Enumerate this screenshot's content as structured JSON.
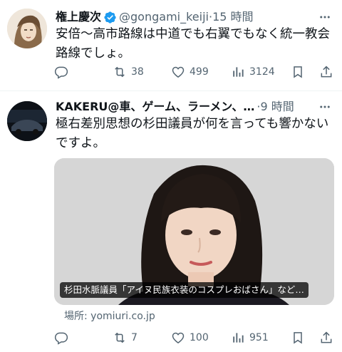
{
  "tweet1": {
    "name": "権上慶次",
    "handle": "@gongami_keiji",
    "separator": "·",
    "time": "15 時間",
    "text_line1": "安倍〜高市路線は中道でも右翼でもなく統一教会",
    "text_line2": "路線でしょ。",
    "actions": {
      "replies": "",
      "retweets": "38",
      "likes": "499",
      "views": "3124"
    }
  },
  "tweet2": {
    "name": "KAKERU@車、ゲーム、ラーメン、…",
    "separator": "·",
    "time": "9 時間",
    "text_line1": "極右差別思想の杉田議員が何を言っても響かない",
    "text_line2": "ですよ。",
    "card": {
      "caption": "杉田水脈議員「アイヌ民族衣装のコスプレおばさん」など…",
      "place_label": "場所: yomiuri.co.jp"
    },
    "actions": {
      "replies": "",
      "retweets": "7",
      "likes": "100",
      "views": "951"
    }
  },
  "icons": [
    "reply-icon",
    "retweet-icon",
    "like-icon",
    "views-icon",
    "bookmark-icon",
    "share-icon",
    "verified-icon",
    "more-icon"
  ],
  "colors": {
    "verified": "#1d9bf0",
    "icon_gray": "#536471",
    "text": "#0f1419",
    "divider": "#eff3f4"
  }
}
